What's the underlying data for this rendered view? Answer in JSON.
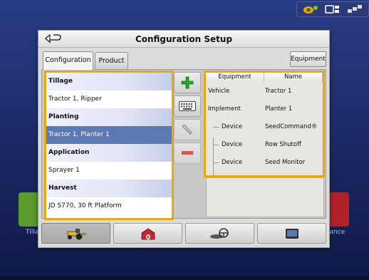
{
  "dialog": {
    "title": "Configuration Setup"
  },
  "tabs": [
    {
      "label": "Configuration",
      "active": true
    },
    {
      "label": "Product",
      "active": false
    }
  ],
  "equipment_button": {
    "label": "Equipment"
  },
  "config_list": [
    {
      "type": "header",
      "label": "Tillage"
    },
    {
      "type": "item",
      "label": "Tractor 1, Ripper"
    },
    {
      "type": "header",
      "label": "Planting"
    },
    {
      "type": "item",
      "label": "Tractor 1, Planter 1",
      "selected": true
    },
    {
      "type": "header",
      "label": "Application"
    },
    {
      "type": "item",
      "label": "Sprayer 1"
    },
    {
      "type": "header",
      "label": "Harvest"
    },
    {
      "type": "item",
      "label": "JD S770, 30 ft Platform"
    }
  ],
  "side_buttons": [
    {
      "icon": "add-icon",
      "enabled": true
    },
    {
      "icon": "keyboard-icon",
      "enabled": true
    },
    {
      "icon": "wrench-icon",
      "enabled": false
    },
    {
      "icon": "remove-icon",
      "enabled": false
    }
  ],
  "detail_table": {
    "columns": [
      "Equipment",
      "Name"
    ],
    "rows": [
      {
        "equipment": "Vehicle",
        "name": "Tractor 1",
        "indent": 0
      },
      {
        "equipment": "Implement",
        "name": "Planter 1",
        "indent": 0
      },
      {
        "equipment": "Device",
        "name": "SeedCommand®",
        "indent": 1
      },
      {
        "equipment": "Device",
        "name": "Row Shutoff",
        "indent": 1
      },
      {
        "equipment": "Device",
        "name": "Seed Monitor",
        "indent": 1
      }
    ]
  },
  "bottom_tabs": [
    {
      "icon": "tractor-icon",
      "active": true
    },
    {
      "icon": "barn-icon",
      "active": false
    },
    {
      "icon": "steering-icon",
      "active": false
    },
    {
      "icon": "display-icon",
      "active": false
    }
  ],
  "background": {
    "left_label": "Tilla",
    "right_label": "lance"
  },
  "colors": {
    "highlight_border": "#e6a817",
    "selected_row": "#5b7ab4",
    "add_green": "#2aa52a",
    "remove_red": "#d9534f"
  }
}
